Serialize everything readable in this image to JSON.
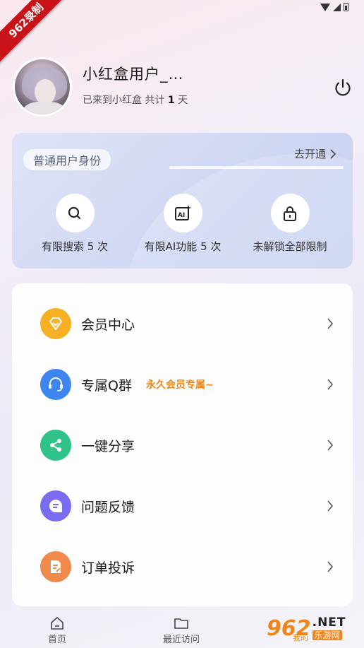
{
  "watermark_badge": "962录制",
  "profile": {
    "username": "小红盒用户_…",
    "subtitle_prefix": "已来到小红盒 共计 ",
    "days": "1",
    "subtitle_suffix": " 天"
  },
  "membership_card": {
    "identity_label": "普通用户身份",
    "open_link_label": "去开通",
    "features": [
      {
        "label": "有限搜索 5 次",
        "icon": "search-icon"
      },
      {
        "label": "有限AI功能 5 次",
        "icon": "ai-icon"
      },
      {
        "label": "未解锁全部限制",
        "icon": "lock-icon"
      }
    ]
  },
  "menu": {
    "items": [
      {
        "label": "会员中心",
        "icon": "vip-diamond-icon",
        "color": "#f5b123"
      },
      {
        "label": "专属Q群",
        "tag": "永久会员专属~",
        "icon": "headset-icon",
        "color": "#3d86f0"
      },
      {
        "label": "一键分享",
        "icon": "share-icon",
        "color": "#2fc289"
      },
      {
        "label": "问题反馈",
        "icon": "feedback-icon",
        "color": "#7a6cf0"
      },
      {
        "label": "订单投诉",
        "icon": "complaint-icon",
        "color": "#f08a4a"
      }
    ]
  },
  "tabbar": {
    "tabs": [
      {
        "label": "首页",
        "icon": "home-icon"
      },
      {
        "label": "最近访问",
        "icon": "folder-icon"
      },
      {
        "label": "我的",
        "icon": "profile-icon"
      }
    ]
  },
  "site_watermark": {
    "logo": "962",
    "net": ".NET",
    "cn": "乐游网"
  },
  "colors": {
    "accent_orange": "#f08a1c",
    "card_bg": "#cfd6f3"
  }
}
